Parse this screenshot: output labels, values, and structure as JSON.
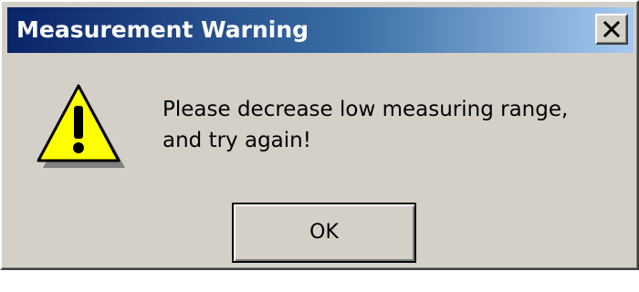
{
  "window": {
    "title": "Measurement Warning",
    "close_icon": "close-icon"
  },
  "body": {
    "icon": "warning-icon",
    "message_lines": [
      "Please decrease low measuring range,",
      "and try again!"
    ]
  },
  "buttons": {
    "ok_label": "OK"
  },
  "colors": {
    "dialog_face": "#d4d0c8",
    "titlebar_start": "#0a246a",
    "titlebar_end": "#a6caf0",
    "warning_fill": "#ffff00"
  }
}
